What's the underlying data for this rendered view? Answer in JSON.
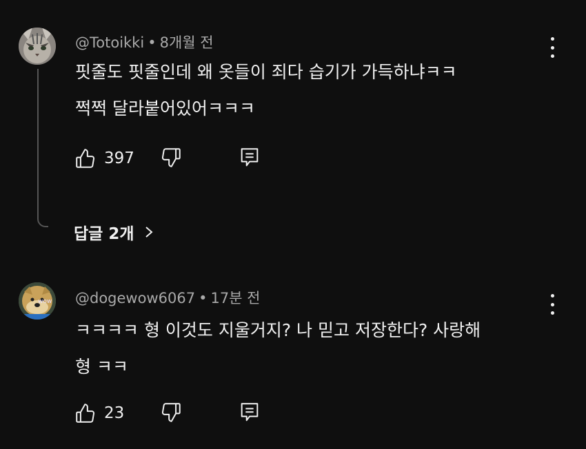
{
  "comments": [
    {
      "author": "@Totoikki",
      "separator": "•",
      "time": "8개월 전",
      "lines": [
        "핏줄도 핏줄인데 왜 옷들이 죄다 습기가 가득하냐ㅋㅋ",
        "쩍쩍 달라붙어있어ㅋㅋㅋ"
      ],
      "likes": "397",
      "replies_label": "답글 2개",
      "avatar_icon": "cat-avatar-icon"
    },
    {
      "author": "@dogewow6067",
      "separator": "•",
      "time": "17분 전",
      "lines": [
        "ㅋㅋㅋㅋ 형 이것도 지울거지? 나 믿고 저장한다? 사랑해",
        "형 ㅋㅋ"
      ],
      "likes": "23",
      "avatar_icon": "doge-avatar-icon"
    }
  ],
  "colors": {
    "background": "#0f0f0f",
    "text_primary": "#f1f1f1",
    "text_secondary": "#aaaaaa",
    "thread_line": "#555555"
  }
}
